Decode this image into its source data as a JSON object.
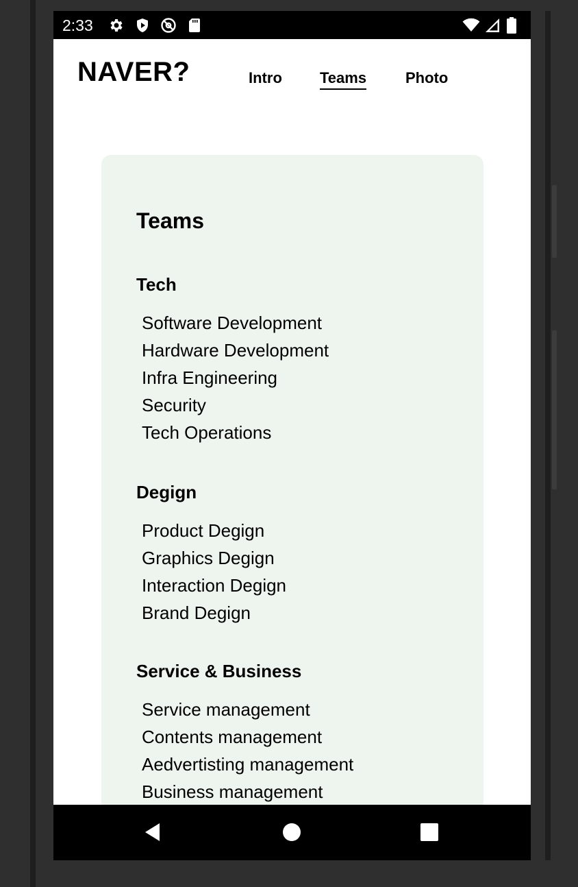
{
  "status_bar": {
    "time": "2:33",
    "left_icons": [
      "gear-icon",
      "shield-play-icon",
      "at-icon",
      "sd-card-icon"
    ],
    "right_icons": [
      "wifi-icon",
      "signal-icon",
      "battery-icon"
    ]
  },
  "header": {
    "logo": "NAVER?",
    "nav": [
      {
        "label": "Intro",
        "active": false
      },
      {
        "label": "Teams",
        "active": true
      },
      {
        "label": "Photo",
        "active": false
      }
    ]
  },
  "card": {
    "title": "Teams",
    "background": "#eef5ee",
    "sections": [
      {
        "title": "Tech",
        "items": [
          "Software Development",
          "Hardware Development",
          "Infra Engineering",
          "Security",
          "Tech Operations"
        ]
      },
      {
        "title": "Degign",
        "items": [
          "Product Degign",
          "Graphics Degign",
          "Interaction Degign",
          "Brand Degign"
        ]
      },
      {
        "title": "Service & Business",
        "items": [
          "Service management",
          "Contents management",
          "Aedvertisting management",
          "Business management"
        ]
      }
    ]
  },
  "system_nav": {
    "back": "back-icon",
    "home": "home-icon",
    "recents": "recents-icon"
  }
}
